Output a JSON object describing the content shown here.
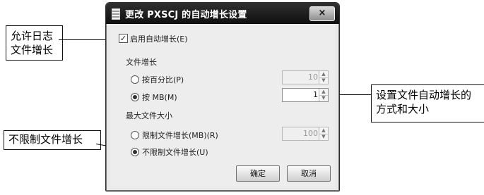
{
  "window": {
    "title": "更改 PXSCJ 的自动增长设置",
    "close_symbol": "×"
  },
  "options": {
    "enable_autogrow_label": "启用自动增长(E)",
    "enable_autogrow_checked": true,
    "file_growth_group": "文件增长",
    "by_percent_label": "按百分比(P)",
    "by_percent_value": "10",
    "by_mb_label": "按 MB(M)",
    "by_mb_value": "1",
    "max_size_group": "最大文件大小",
    "limit_growth_label": "限制文件增长(MB)(R)",
    "limit_growth_value": "100",
    "unlimited_label": "不限制文件增长(U)",
    "selected_growth_mode": "by_mb",
    "selected_max_mode": "unlimited"
  },
  "buttons": {
    "ok": "确定",
    "cancel": "取消"
  },
  "annotations": {
    "allow_growth": "允许日志\n文件增长",
    "set_growth": "设置文件自动增长的\n方式和大小",
    "unlimited": "不限制文件增长"
  },
  "icons": {
    "app_icon": "window-document-icon",
    "close": "close-icon",
    "spinner": "spinner-arrows-icon"
  }
}
